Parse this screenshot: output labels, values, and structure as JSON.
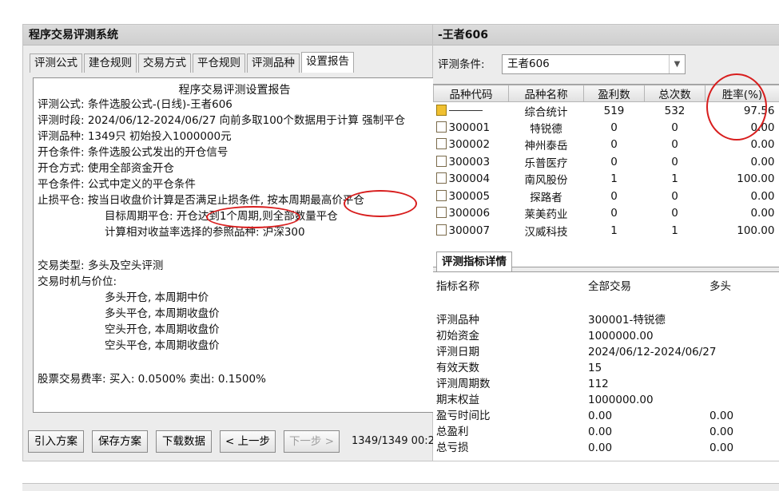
{
  "left_window": {
    "title": "程序交易评测系统",
    "tabs": [
      {
        "label": "评测公式"
      },
      {
        "label": "建仓规则"
      },
      {
        "label": "交易方式"
      },
      {
        "label": "平仓规则"
      },
      {
        "label": "评测品种"
      },
      {
        "label": "设置报告"
      }
    ],
    "report": {
      "title": "程序交易评测设置报告",
      "lines": [
        "评测公式: 条件选股公式-(日线)-王者606",
        "评测时段: 2024/06/12-2024/06/27 向前多取100个数据用于计算 强制平仓",
        "评测品种: 1349只 初始投入1000000元",
        "开仓条件: 条件选股公式发出的开仓信号",
        "开仓方式: 使用全部资金开仓",
        "平仓条件: 公式中定义的平仓条件",
        "止损平仓: 按当日收盘价计算是否满足止损条件, 按本周期最高价平仓",
        "目标周期平仓: 开仓达到1个周期,则全部数量平仓",
        "计算相对收益率选择的参照品种: 沪深300",
        "交易类型: 多头及空头评测",
        "交易时机与价位:",
        "多头开仓, 本周期中价",
        "多头平仓, 本周期收盘价",
        "空头开仓, 本周期收盘价",
        "空头平仓, 本周期收盘价",
        "股票交易费率: 买入: 0.0500% 卖出: 0.1500%"
      ]
    },
    "buttons": {
      "import": "引入方案",
      "save": "保存方案",
      "download": "下载数据",
      "prev": "< 上一步",
      "next": "下一步 >"
    },
    "counter": "1349/1349 00:2"
  },
  "right_window": {
    "title": "-王者606",
    "condition_label": "评测条件:",
    "condition_value": "王者606",
    "table": {
      "headers": [
        "品种代码",
        "品种名称",
        "盈利数",
        "总次数",
        "胜率(%)"
      ],
      "rows": [
        {
          "code": "",
          "name": "综合统计",
          "profit": "519",
          "total": "532",
          "rate": "97.56"
        },
        {
          "code": "300001",
          "name": "特锐德",
          "profit": "0",
          "total": "0",
          "rate": "0.00"
        },
        {
          "code": "300002",
          "name": "神州泰岳",
          "profit": "0",
          "total": "0",
          "rate": "0.00"
        },
        {
          "code": "300003",
          "name": "乐普医疗",
          "profit": "0",
          "total": "0",
          "rate": "0.00"
        },
        {
          "code": "300004",
          "name": "南风股份",
          "profit": "1",
          "total": "1",
          "rate": "100.00"
        },
        {
          "code": "300005",
          "name": "探路者",
          "profit": "0",
          "total": "0",
          "rate": "0.00"
        },
        {
          "code": "300006",
          "name": "莱美药业",
          "profit": "0",
          "total": "0",
          "rate": "0.00"
        },
        {
          "code": "300007",
          "name": "汉威科技",
          "profit": "1",
          "total": "1",
          "rate": "100.00"
        }
      ]
    },
    "detail_tab": "评测指标详情",
    "detail": {
      "headers": [
        "指标名称",
        "全部交易",
        "多头"
      ],
      "rows": [
        {
          "name": "评测品种",
          "all": "300001-特锐德",
          "long": ""
        },
        {
          "name": "初始资金",
          "all": "1000000.00",
          "long": ""
        },
        {
          "name": "评测日期",
          "all": "2024/06/12-2024/06/27",
          "long": ""
        },
        {
          "name": "有效天数",
          "all": "15",
          "long": ""
        },
        {
          "name": "评测周期数",
          "all": "112",
          "long": ""
        },
        {
          "name": "期末权益",
          "all": "1000000.00",
          "long": ""
        },
        {
          "name": "盈亏时间比",
          "all": "0.00",
          "long": "0.00"
        },
        {
          "name": "总盈利",
          "all": "0.00",
          "long": "0.00"
        },
        {
          "name": "总亏损",
          "all": "0.00",
          "long": "0.00"
        }
      ]
    }
  },
  "annotation_color": "#d81e1e"
}
